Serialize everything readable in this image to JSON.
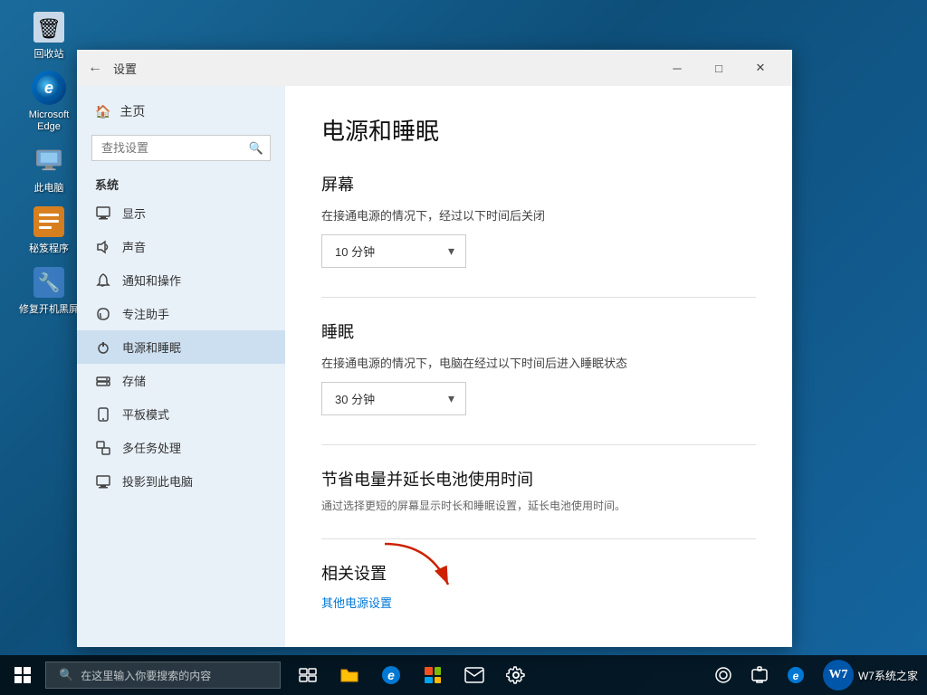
{
  "desktop": {
    "icons": [
      {
        "id": "recycle",
        "label": "回收站",
        "type": "recycle"
      },
      {
        "id": "edge",
        "label": "Microsoft\nEdge",
        "type": "edge"
      },
      {
        "id": "pc",
        "label": "此电脑",
        "type": "pc"
      },
      {
        "id": "apps",
        "label": "秘笈程序",
        "type": "apps"
      },
      {
        "id": "fix",
        "label": "修复开机黑屏",
        "type": "fix"
      }
    ]
  },
  "window": {
    "title": "设置",
    "back_label": "←",
    "minimize_label": "─",
    "maximize_label": "□",
    "close_label": "✕"
  },
  "sidebar": {
    "home_label": "主页",
    "search_placeholder": "查找设置",
    "section_title": "系统",
    "items": [
      {
        "id": "display",
        "label": "显示",
        "icon": "🖥"
      },
      {
        "id": "sound",
        "label": "声音",
        "icon": "🔊"
      },
      {
        "id": "notifications",
        "label": "通知和操作",
        "icon": "🔔"
      },
      {
        "id": "focus",
        "label": "专注助手",
        "icon": "🌙"
      },
      {
        "id": "power",
        "label": "电源和睡眠",
        "icon": "⏻",
        "active": true
      },
      {
        "id": "storage",
        "label": "存储",
        "icon": "💾"
      },
      {
        "id": "tablet",
        "label": "平板模式",
        "icon": "📱"
      },
      {
        "id": "multitask",
        "label": "多任务处理",
        "icon": "🗗"
      },
      {
        "id": "project",
        "label": "投影到此电脑",
        "icon": "🖥"
      }
    ]
  },
  "main": {
    "title": "电源和睡眠",
    "screen_section": {
      "heading": "屏幕",
      "desc": "在接通电源的情况下，经过以下时间后关闭",
      "value": "10 分钟"
    },
    "sleep_section": {
      "heading": "睡眠",
      "desc": "在接通电源的情况下，电脑在经过以下时间后进入睡眠状态",
      "value": "30 分钟"
    },
    "battery_section": {
      "heading": "节省电量并延长电池使用时间",
      "desc": "通过选择更短的屏幕显示时长和睡眠设置，延长电池使用时间。"
    },
    "related_section": {
      "heading": "相关设置",
      "link": "其他电源设置"
    }
  },
  "taskbar": {
    "search_placeholder": "在这里输入你要搜索的内容",
    "apps": [
      {
        "id": "task-view",
        "icon": "⬜"
      },
      {
        "id": "file-explorer",
        "icon": "📁"
      },
      {
        "id": "edge",
        "icon": "e"
      },
      {
        "id": "store",
        "icon": "🏪"
      },
      {
        "id": "mail",
        "icon": "✉"
      },
      {
        "id": "settings",
        "icon": "⚙"
      }
    ],
    "sys_icons": [
      "🌙",
      "🔔",
      "e"
    ],
    "watermark_text": "W7系统之家"
  }
}
